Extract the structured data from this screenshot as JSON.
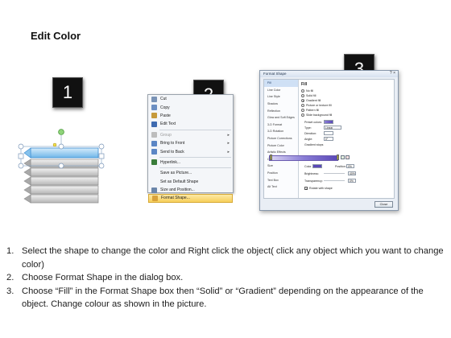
{
  "title": "Edit Color",
  "badges": [
    "1",
    "2",
    "3"
  ],
  "context_menu": {
    "items": [
      {
        "label": "Cut",
        "underline": "t",
        "icon": "scissors-icon",
        "color": "#7a93b6"
      },
      {
        "label": "Copy",
        "icon": "copy-icon",
        "color": "#6c8fc2"
      },
      {
        "label": "Paste",
        "icon": "paste-icon",
        "color": "#c69a3b"
      },
      {
        "label": "Edit Text",
        "icon": "text-icon",
        "color": "#3f6bb0"
      },
      {
        "label": "Group",
        "disabled": true,
        "submenu": true,
        "icon": "group-icon",
        "color": "#bdbdbd"
      },
      {
        "label": "Bring to Front",
        "submenu": true,
        "icon": "bring-front-icon",
        "color": "#5b86c5"
      },
      {
        "label": "Send to Back",
        "submenu": true,
        "icon": "send-back-icon",
        "color": "#5b86c5"
      },
      {
        "label": "Hyperlink...",
        "icon": "hyperlink-icon",
        "color": "#3a7d3a"
      },
      {
        "label": "Save as Picture...",
        "icon": "",
        "color": ""
      },
      {
        "label": "Set as Default Shape",
        "icon": "",
        "color": ""
      },
      {
        "label": "Size and Position...",
        "icon": "size-icon",
        "color": "#6b86aa"
      },
      {
        "label": "Format Shape...",
        "highlighted": true,
        "icon": "format-shape-icon",
        "color": "#d9a23a"
      }
    ]
  },
  "dialog": {
    "title": "Format Shape",
    "close_glyph": "? ×",
    "side_items": [
      "Fill",
      "Line Color",
      "Line Style",
      "Shadow",
      "Reflection",
      "Glow and Soft Edges",
      "3-D Format",
      "3-D Rotation",
      "Picture Corrections",
      "Picture Color",
      "Artistic Effects",
      "Crop",
      "Size",
      "Position",
      "Text Box",
      "Alt Text"
    ],
    "selected_side": "Fill",
    "heading": "Fill",
    "radios": [
      {
        "label": "No fill",
        "on": false
      },
      {
        "label": "Solid fill",
        "on": false
      },
      {
        "label": "Gradient fill",
        "on": true
      },
      {
        "label": "Picture or texture fill",
        "on": false
      },
      {
        "label": "Pattern fill",
        "on": false
      },
      {
        "label": "Slide background fill",
        "on": false
      }
    ],
    "preset_colors_label": "Preset colors:",
    "type_label": "Type:",
    "type_value": "Linear",
    "direction_label": "Direction:",
    "angle_label": "Angle:",
    "angle_value": "0°",
    "gradient_stops_label": "Gradient stops",
    "color_label": "Color",
    "position_label": "Position:",
    "position_value": "0%",
    "brightness_label": "Brightness:",
    "brightness_value": "40%",
    "transparency_label": "Transparency:",
    "transparency_value": "0%",
    "rotate_label": "Rotate with shape",
    "close_label": "Close",
    "gradient_colors": [
      "#dcd7f4",
      "#8a7ed6",
      "#5a48b7"
    ]
  },
  "steps": [
    {
      "num": "1.",
      "text": "Select the shape to change the color and Right click the object( click any object which you want to change color)"
    },
    {
      "num": "2.",
      "text": "Choose Format Shape in the dialog box."
    },
    {
      "num": "3.",
      "text": "Choose “Fill” in the Format Shape box then “Solid” or “Gradient” depending on the appearance of the object. Change colour as shown in the picture."
    }
  ]
}
